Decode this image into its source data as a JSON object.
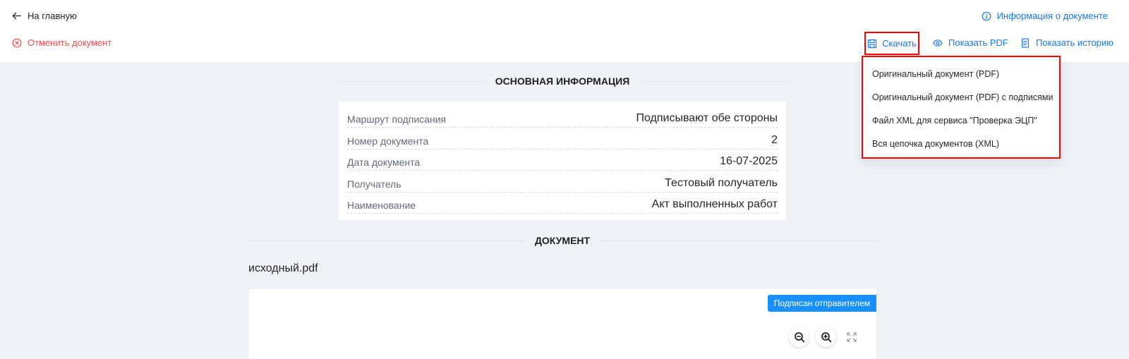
{
  "header": {
    "back_label": "На главную",
    "cancel_label": "Отменить документ",
    "doc_info_label": "Информация о документе"
  },
  "toolbar": {
    "download_label": "Скачать",
    "show_pdf_label": "Показать PDF",
    "show_history_label": "Показать историю"
  },
  "download_menu": {
    "items": [
      "Оригинальный документ (PDF)",
      "Оригинальный документ (PDF) с подписями",
      "Файл XML для сервиса \"Проверка ЭЦП\"",
      "Вся цепочка документов (XML)"
    ]
  },
  "main_info": {
    "title": "ОСНОВНАЯ ИНФОРМАЦИЯ",
    "rows": [
      {
        "label": "Маршрут подписания",
        "value": "Подписывают обе стороны"
      },
      {
        "label": "Номер документа",
        "value": "2"
      },
      {
        "label": "Дата документа",
        "value": "16-07-2025"
      },
      {
        "label": "Получатель",
        "value": "Тестовый получатель"
      },
      {
        "label": "Наименование",
        "value": "Акт выполненных работ"
      }
    ]
  },
  "document": {
    "title": "ДОКУМЕНТ",
    "filename": "исходный.pdf",
    "badge": "Подписан отправителем"
  },
  "icons": {
    "back": "arrow-left-icon",
    "cancel": "close-circle-icon",
    "info": "info-circle-icon",
    "download": "save-icon",
    "show_pdf": "eye-icon",
    "history": "file-text-icon",
    "zoom_out": "zoom-out-icon",
    "zoom_in": "zoom-in-icon",
    "fullscreen": "expand-icon"
  },
  "colors": {
    "accent": "#1677ff",
    "danger": "#ff4d4f",
    "highlight": "#ff0000",
    "badge": "#1890ff",
    "page_bg": "#eef1f6"
  }
}
